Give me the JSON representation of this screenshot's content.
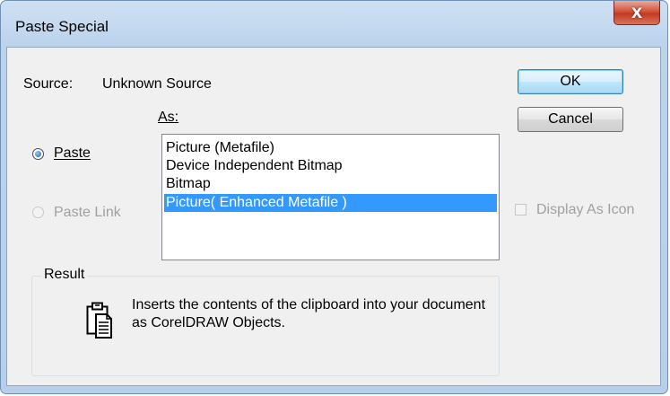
{
  "window": {
    "title": "Paste Special",
    "close_glyph": "X"
  },
  "source": {
    "label": "Source:",
    "value": "Unknown Source"
  },
  "as_label": "As:",
  "buttons": {
    "ok": "OK",
    "cancel": "Cancel"
  },
  "options": {
    "paste": "Paste",
    "paste_link": "Paste Link",
    "selected": "paste"
  },
  "format_list": {
    "items": [
      "Picture (Metafile)",
      "Device Independent Bitmap",
      "Bitmap",
      "Picture( Enhanced Metafile )"
    ],
    "selected_index": 3
  },
  "display_as_icon": {
    "label": "Display As Icon",
    "checked": false,
    "enabled": false
  },
  "result": {
    "label": "Result",
    "text": "Inserts the contents of the clipboard into your document as CorelDRAW Objects.",
    "icon": "clipboard-paste-icon"
  },
  "colors": {
    "selection": "#3399ff",
    "close_button": "#c7432b",
    "disabled_text": "#a0a0a0"
  }
}
